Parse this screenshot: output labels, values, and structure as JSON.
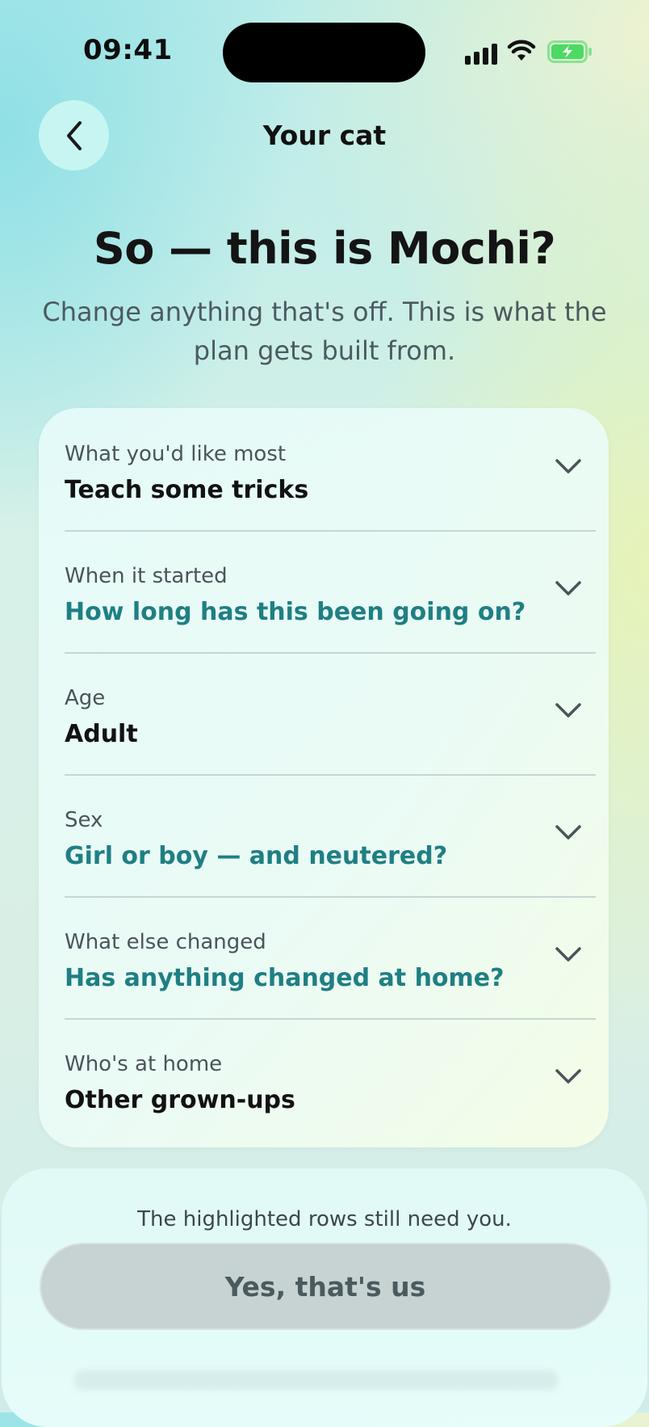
{
  "status_bar": {
    "time": "09:41",
    "icons": [
      "cellular-signal-icon",
      "wifi-icon",
      "battery-charging-icon"
    ],
    "battery_color": "#4cd964"
  },
  "header": {
    "back_icon": "chevron-left-icon",
    "title": "Your cat"
  },
  "intro": {
    "headline": "So — this is Mochi?",
    "subtitle": "Change anything that's off. This is what the plan gets built from."
  },
  "rows": [
    {
      "label": "What you'd like most",
      "value": "Teach some tricks",
      "needs_input": false
    },
    {
      "label": "When it started",
      "value": "How long has this been going on?",
      "needs_input": true
    },
    {
      "label": "Age",
      "value": "Adult",
      "needs_input": false
    },
    {
      "label": "Sex",
      "value": "Girl or boy — and neutered?",
      "needs_input": true
    },
    {
      "label": "What else changed",
      "value": "Has anything changed at home?",
      "needs_input": true
    },
    {
      "label": "Who's at home",
      "value": "Other grown-ups",
      "needs_input": false
    }
  ],
  "footer": {
    "hint": "The highlighted rows still need you.",
    "cta_label": "Yes, that's us",
    "cta_enabled": false
  },
  "colors": {
    "accent_teal": "#1f7f83",
    "cta_disabled_bg": "#c6d3d2",
    "back_button_bg": "#c7f6f2"
  }
}
